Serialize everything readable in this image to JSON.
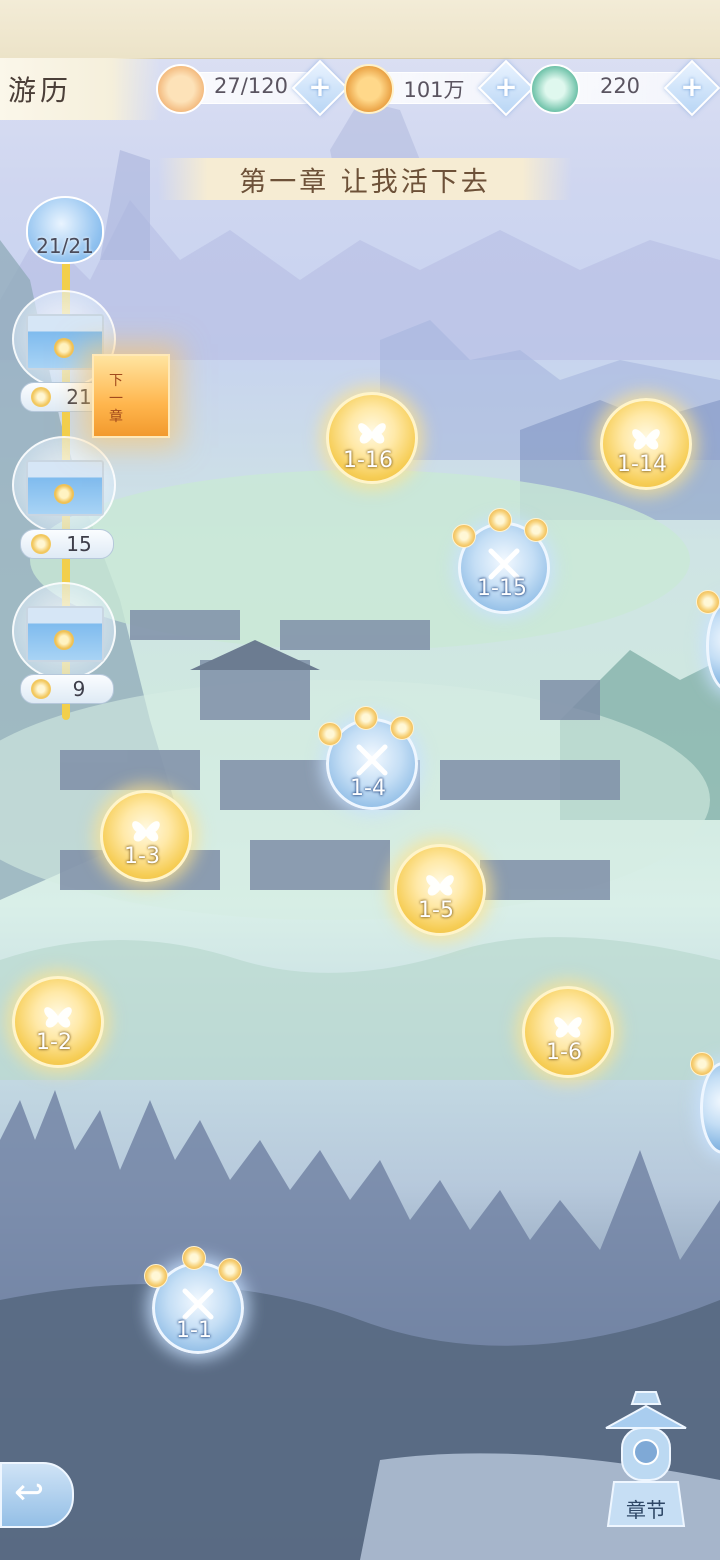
{
  "header": {
    "title": "游历",
    "resources": [
      {
        "icon": "stamina-cat-icon",
        "value": "27/120"
      },
      {
        "icon": "coin-icon",
        "value": "101万"
      },
      {
        "icon": "jade-dragon-icon",
        "value": "220"
      }
    ],
    "add_label": "+"
  },
  "chapter": {
    "title": "第一章 让我活下去"
  },
  "progress": {
    "total": "21/21",
    "rewards": [
      {
        "value": "21"
      },
      {
        "value": "15"
      },
      {
        "value": "9"
      }
    ]
  },
  "next_chapter_label": "下一章",
  "stages": [
    {
      "label": "1-1",
      "type": "battle"
    },
    {
      "label": "1-2",
      "type": "story"
    },
    {
      "label": "1-3",
      "type": "story"
    },
    {
      "label": "1-4",
      "type": "battle"
    },
    {
      "label": "1-5",
      "type": "story"
    },
    {
      "label": "1-6",
      "type": "story"
    },
    {
      "label": "1-14",
      "type": "story"
    },
    {
      "label": "1-15",
      "type": "battle"
    },
    {
      "label": "1-16",
      "type": "story"
    }
  ],
  "footer": {
    "back_icon": "back-arrow-icon",
    "chapter_label": "章节"
  }
}
